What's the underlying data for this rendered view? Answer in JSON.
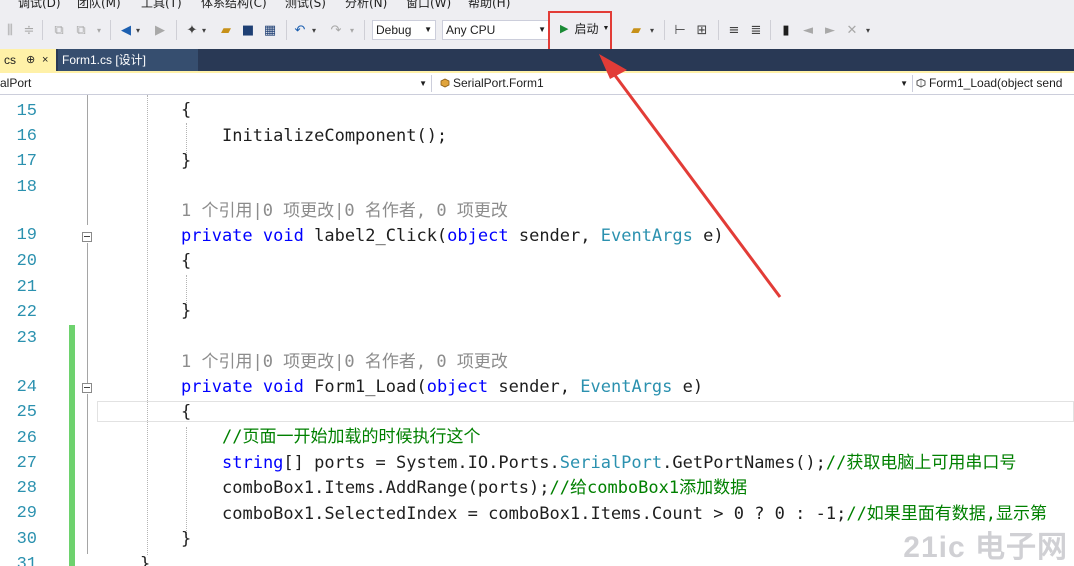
{
  "menu": [
    "调试(D)",
    "团队(M)",
    "工具(T)",
    "体系结构(C)",
    "测试(S)",
    "分析(N)",
    "窗口(W)",
    "帮助(H)"
  ],
  "toolbar": {
    "config": "Debug",
    "platform": "Any CPU",
    "start_label": "启动"
  },
  "tabs": {
    "active": "cs",
    "active_pin": "⊕",
    "active_close": "×",
    "design": "Form1.cs [设计]"
  },
  "navbar": {
    "project": "alPort",
    "class": "SerialPort.Form1",
    "member": "Form1_Load(object send"
  },
  "editor": {
    "line_numbers": [
      "15",
      "16",
      "17",
      "18",
      "19",
      "20",
      "21",
      "22",
      "23",
      "24",
      "25",
      "26",
      "27",
      "28",
      "29",
      "30",
      "31"
    ],
    "codelens": "1 个引用|0 项更改|0 名作者, 0 项更改",
    "code": {
      "l15_brace": "{",
      "l16_call": "InitializeComponent();",
      "l17_brace": "}",
      "l19_kw1": "private",
      "l19_kw2": "void",
      "l19_name": "label2_Click(",
      "l19_kw3": "object",
      "l19_p1": "sender,",
      "l19_ty": "EventArgs",
      "l19_p2": "e)",
      "l20_brace": "{",
      "l22_brace": "}",
      "l24_kw1": "private",
      "l24_kw2": "void",
      "l24_name": "Form1_Load(",
      "l24_kw3": "object",
      "l24_p1": "sender,",
      "l24_ty": "EventArgs",
      "l24_p2": "e)",
      "l25_brace": "{",
      "l26_comment": "//页面一开始加载的时候执行这个",
      "l27_kw": "string",
      "l27_a": "[] ports = System.IO.Ports.",
      "l27_ty": "SerialPort",
      "l27_b": ".GetPortNames();",
      "l27_comment": "//获取电脑上可用串口号",
      "l28_code": "comboBox1.Items.AddRange(ports);",
      "l28_comment": "//给comboBox1添加数据",
      "l29_code": "comboBox1.SelectedIndex = comboBox1.Items.Count > 0 ? 0 : -1;",
      "l29_comment": "//如果里面有数据,显示第",
      "l30_brace": "}",
      "l31_brace": "}"
    }
  },
  "watermark": "21ic 电子网",
  "colors": {
    "keyword": "#0000ff",
    "type": "#2b91af",
    "comment": "#008000",
    "annotation": "#e23c37",
    "tab_active": "#fff1a8",
    "tabstrip": "#293955"
  }
}
